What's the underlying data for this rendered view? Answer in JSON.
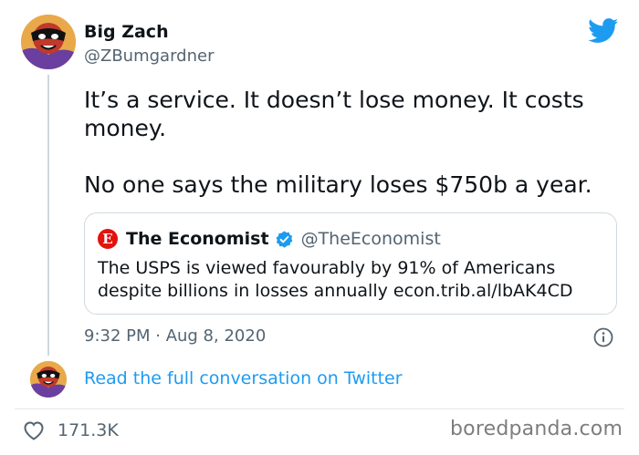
{
  "author": {
    "name": "Big Zach",
    "handle": "@ZBumgardner",
    "avatar": "masked-cartoon-avatar"
  },
  "tweet": {
    "text_line1": "It’s a service. It doesn’t lose money. It costs money.",
    "text_line2": "No one says the military loses $750b a year.",
    "timestamp": "9:32 PM · Aug 8, 2020"
  },
  "quote": {
    "logo_letter": "E",
    "name": "The Economist",
    "handle": "@TheEconomist",
    "verified": true,
    "text": "The USPS is viewed favourably by 91% of Americans despite billions in losses annually econ.trib.al/lbAK4CD"
  },
  "footer": {
    "read_link": "Read the full conversation on Twitter",
    "likes": "171.3K"
  },
  "watermark": "boredpanda.com",
  "icons": {
    "brand": "twitter-bird-icon",
    "info": "info-icon",
    "like": "heart-icon",
    "verified": "verified-badge-icon"
  },
  "colors": {
    "twitter_blue": "#1d9bf0",
    "economist_red": "#e3120b",
    "secondary_text": "#536471",
    "border": "#cfd9de"
  }
}
